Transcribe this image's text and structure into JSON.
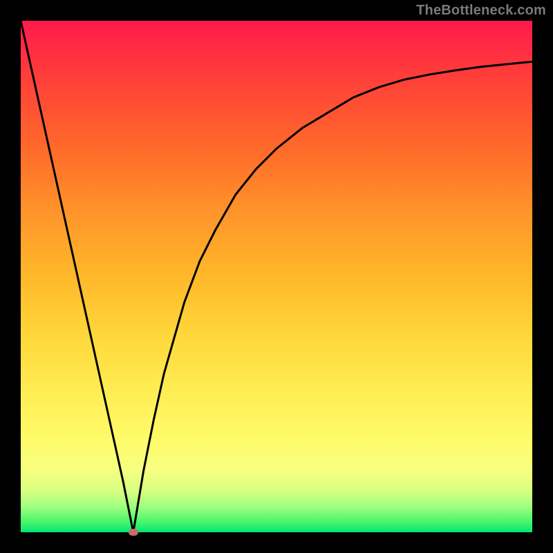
{
  "watermark": {
    "text": "TheBottleneck.com"
  },
  "chart_data": {
    "type": "line",
    "title": "",
    "xlabel": "",
    "ylabel": "",
    "xlim": [
      0,
      100
    ],
    "ylim": [
      0,
      100
    ],
    "grid": false,
    "legend": false,
    "background": "gradient-red-to-green-vertical",
    "minimum": {
      "x": 22,
      "y": 0
    },
    "series": [
      {
        "name": "bottleneck-curve",
        "color": "#000000",
        "x": [
          0,
          2,
          4,
          6,
          8,
          10,
          12,
          14,
          16,
          18,
          20,
          21,
          22,
          23,
          24,
          26,
          28,
          30,
          32,
          35,
          38,
          42,
          46,
          50,
          55,
          60,
          65,
          70,
          75,
          80,
          85,
          90,
          95,
          100
        ],
        "y": [
          100,
          91,
          82,
          73,
          64,
          55,
          46,
          37,
          28,
          19,
          10,
          5,
          0,
          6,
          12,
          22,
          31,
          38,
          45,
          53,
          59,
          66,
          71,
          75,
          79,
          82,
          85,
          87,
          88.5,
          89.5,
          90.3,
          91,
          91.5,
          92
        ]
      }
    ],
    "markers": [
      {
        "name": "minimum-marker",
        "x": 22,
        "y": 0,
        "color": "#c96a6a"
      }
    ]
  }
}
